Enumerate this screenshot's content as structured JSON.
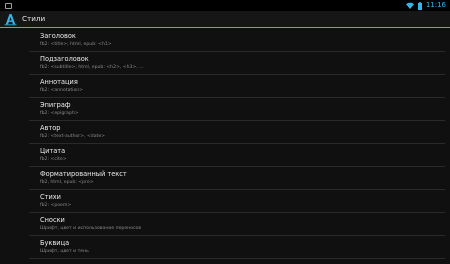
{
  "status_bar": {
    "time": "11:16",
    "icons": [
      "notification-icon",
      "wifi-icon",
      "battery-icon"
    ]
  },
  "action_bar": {
    "title": "Стили",
    "logo_icon": "app-logo-icon"
  },
  "colors": {
    "accent": "#33b5e5",
    "background": "#101010",
    "primary_text": "#ededed",
    "secondary_text": "#8a8a8a"
  },
  "styles_list": [
    {
      "title": "Заголовок",
      "subtitle": "fb2: <title>; html, epub: <h1>"
    },
    {
      "title": "Подзаголовок",
      "subtitle": "fb2: <subtitle>; html, epub: <h2>, <h3>, ..."
    },
    {
      "title": "Аннотация",
      "subtitle": "fb2: <annotation>"
    },
    {
      "title": "Эпиграф",
      "subtitle": "fb2: <epigraph>"
    },
    {
      "title": "Автор",
      "subtitle": "fb2: <text-author>, <date>"
    },
    {
      "title": "Цитата",
      "subtitle": "fb2: <cite>"
    },
    {
      "title": "Форматированный текст",
      "subtitle": "fb2, html, epub: <pre>"
    },
    {
      "title": "Стихи",
      "subtitle": "fb2: <poem>"
    },
    {
      "title": "Сноски",
      "subtitle": "Шрифт, цвет и использование переносов"
    },
    {
      "title": "Буквица",
      "subtitle": "Шрифт, цвет и тень"
    }
  ]
}
